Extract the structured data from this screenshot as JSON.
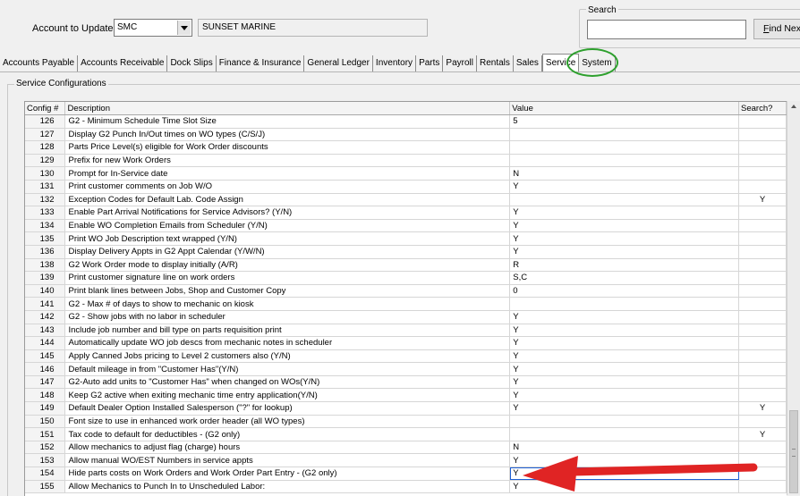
{
  "account": {
    "label": "Account to Update",
    "code": "SMC",
    "name": "SUNSET MARINE"
  },
  "search": {
    "legend": "Search",
    "value": "",
    "find_label_underlined": "F",
    "find_label_rest": "ind Nex"
  },
  "tabs": [
    {
      "label": "Accounts Payable"
    },
    {
      "label": "Accounts Receivable"
    },
    {
      "label": "Dock Slips"
    },
    {
      "label": "Finance & Insurance"
    },
    {
      "label": "General Ledger"
    },
    {
      "label": "Inventory"
    },
    {
      "label": "Parts"
    },
    {
      "label": "Payroll"
    },
    {
      "label": "Rentals"
    },
    {
      "label": "Sales"
    },
    {
      "label": "Service"
    },
    {
      "label": "System"
    }
  ],
  "active_tab": "Service",
  "group_title": "Service Configurations",
  "grid": {
    "columns": {
      "config": "Config #",
      "description": "Description",
      "value": "Value",
      "search": "Search?"
    },
    "rows": [
      {
        "n": "126",
        "d": "G2 - Minimum Schedule Time Slot Size",
        "v": "5",
        "s": ""
      },
      {
        "n": "127",
        "d": "Display G2 Punch In/Out times on WO types (C/S/J)",
        "v": "",
        "s": ""
      },
      {
        "n": "128",
        "d": "Parts Price Level(s) eligible for Work Order discounts",
        "v": "",
        "s": ""
      },
      {
        "n": "129",
        "d": "Prefix for new Work Orders",
        "v": "",
        "s": ""
      },
      {
        "n": "130",
        "d": "Prompt for In-Service date",
        "v": "N",
        "s": ""
      },
      {
        "n": "131",
        "d": "Print customer comments on Job W/O",
        "v": "Y",
        "s": ""
      },
      {
        "n": "132",
        "d": "Exception Codes for Default Lab. Code Assign",
        "v": "",
        "s": "Y"
      },
      {
        "n": "133",
        "d": "Enable Part Arrival Notifications for Service Advisors? (Y/N)",
        "v": "Y",
        "s": ""
      },
      {
        "n": "134",
        "d": "Enable WO Completion Emails from Scheduler (Y/N)",
        "v": "Y",
        "s": ""
      },
      {
        "n": "135",
        "d": "Print WO Job Description text wrapped (Y/N)",
        "v": "Y",
        "s": ""
      },
      {
        "n": "136",
        "d": "Display Delivery Appts in G2 Appt Calendar (Y/W/N)",
        "v": "Y",
        "s": ""
      },
      {
        "n": "138",
        "d": "G2 Work Order mode to display initially (A/R)",
        "v": "R",
        "s": ""
      },
      {
        "n": "139",
        "d": "Print customer signature line on work orders",
        "v": "S,C",
        "s": ""
      },
      {
        "n": "140",
        "d": "Print blank lines between Jobs, Shop and Customer Copy",
        "v": "0",
        "s": ""
      },
      {
        "n": "141",
        "d": "G2 - Max # of days to show to mechanic on kiosk",
        "v": "",
        "s": ""
      },
      {
        "n": "142",
        "d": "G2 - Show jobs with no labor in scheduler",
        "v": "Y",
        "s": ""
      },
      {
        "n": "143",
        "d": "Include job number and bill type on parts requisition print",
        "v": "Y",
        "s": ""
      },
      {
        "n": "144",
        "d": "Automatically update WO job descs from mechanic notes in scheduler",
        "v": "Y",
        "s": ""
      },
      {
        "n": "145",
        "d": "Apply Canned Jobs pricing to Level 2 customers also (Y/N)",
        "v": "Y",
        "s": ""
      },
      {
        "n": "146",
        "d": "Default mileage in from \"Customer Has\"(Y/N)",
        "v": "Y",
        "s": ""
      },
      {
        "n": "147",
        "d": "G2-Auto add units to \"Customer Has\" when changed on WOs(Y/N)",
        "v": "Y",
        "s": ""
      },
      {
        "n": "148",
        "d": "Keep G2 active when exiting mechanic time entry application(Y/N)",
        "v": "Y",
        "s": ""
      },
      {
        "n": "149",
        "d": "Default Dealer Option Installed Salesperson (\"?\" for lookup)",
        "v": "Y",
        "s": "Y"
      },
      {
        "n": "150",
        "d": "Font size to use in enhanced work order header (all WO types)",
        "v": "",
        "s": ""
      },
      {
        "n": "151",
        "d": "Tax code to default for deductibles - (G2 only)",
        "v": "",
        "s": "Y"
      },
      {
        "n": "152",
        "d": "Allow mechanics to adjust flag (charge) hours",
        "v": "N",
        "s": ""
      },
      {
        "n": "153",
        "d": "Allow manual WO/EST Numbers in service appts",
        "v": "Y",
        "s": ""
      },
      {
        "n": "154",
        "d": "Hide parts costs on Work Orders and Work Order Part Entry - (G2 only)",
        "v": "Y",
        "s": "",
        "selected": true
      },
      {
        "n": "155",
        "d": "Allow Mechanics to Punch In to Unscheduled Labor:",
        "v": "Y",
        "s": ""
      }
    ]
  },
  "colors": {
    "highlight_ring": "#2ea02e",
    "arrow": "#e02424",
    "selection": "#1e5fd4"
  }
}
